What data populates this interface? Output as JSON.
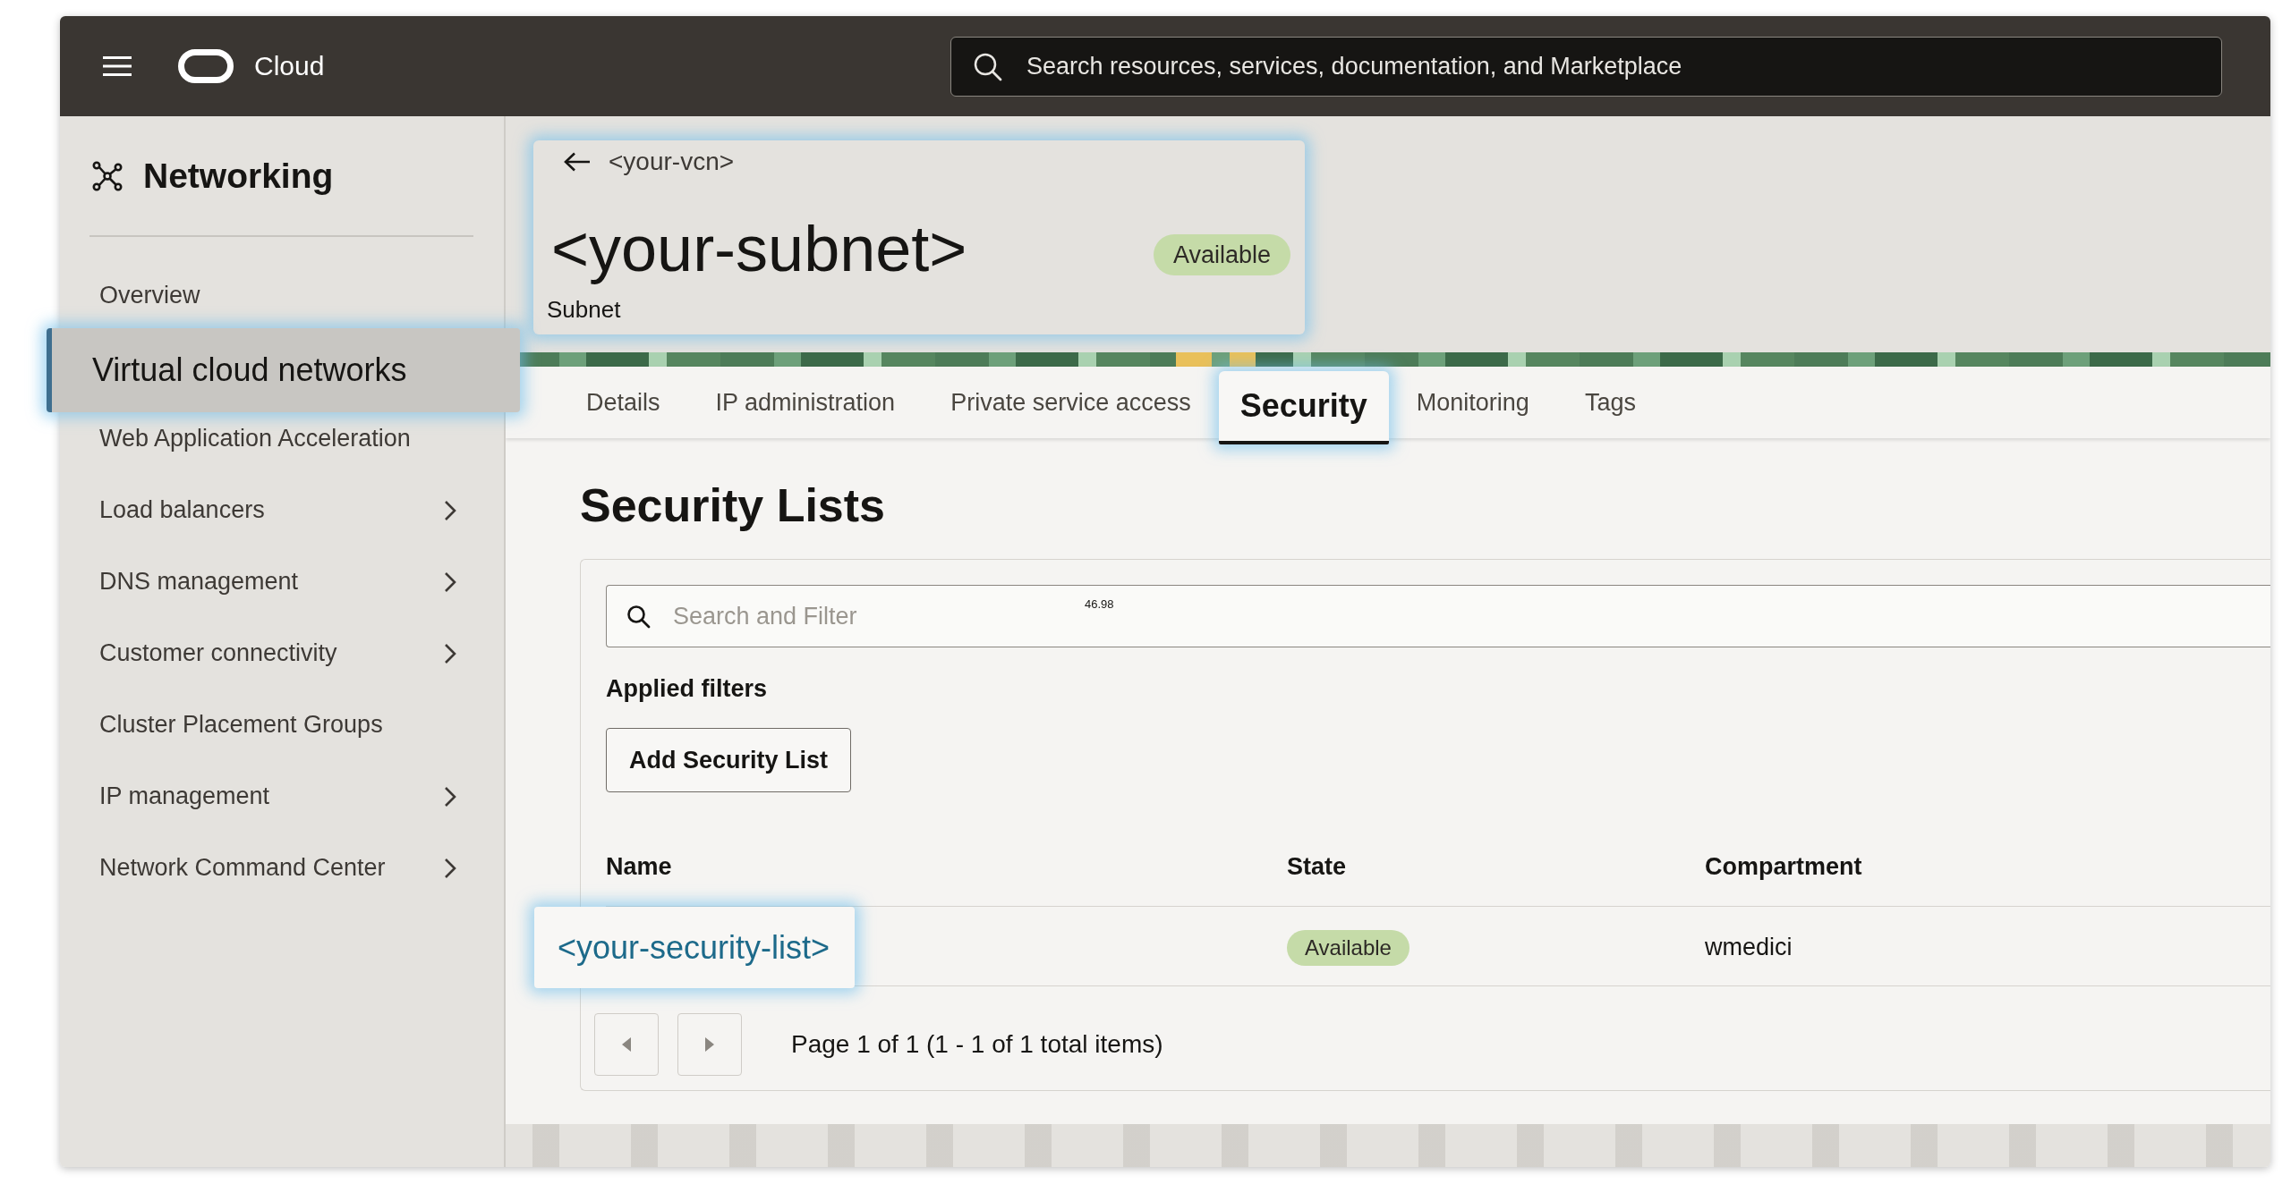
{
  "top_bar": {
    "brand": "Cloud",
    "search": {
      "placeholder": "Search resources, services, documentation, and Marketplace"
    }
  },
  "sidebar": {
    "title": "Networking",
    "items": [
      {
        "label": "Overview",
        "selected": false,
        "expandable": false
      },
      {
        "label": "Virtual cloud networks",
        "selected": true,
        "expandable": false
      },
      {
        "label": "Web Application Acceleration",
        "selected": false,
        "expandable": false
      },
      {
        "label": "Load balancers",
        "selected": false,
        "expandable": true
      },
      {
        "label": "DNS management",
        "selected": false,
        "expandable": true
      },
      {
        "label": "Customer connectivity",
        "selected": false,
        "expandable": true
      },
      {
        "label": "Cluster Placement Groups",
        "selected": false,
        "expandable": false
      },
      {
        "label": "IP management",
        "selected": false,
        "expandable": true
      },
      {
        "label": "Network Command Center",
        "selected": false,
        "expandable": true
      }
    ]
  },
  "header": {
    "back_link": "<your-vcn>",
    "title": "<your-subnet>",
    "status": "Available",
    "subtitle": "Subnet",
    "highlighted": true
  },
  "tabs": [
    {
      "label": "Details",
      "selected": false
    },
    {
      "label": "IP administration",
      "selected": false
    },
    {
      "label": "Private service access",
      "selected": false
    },
    {
      "label": "Security",
      "selected": true
    },
    {
      "label": "Monitoring",
      "selected": false
    },
    {
      "label": "Tags",
      "selected": false
    }
  ],
  "section": {
    "title": "Security Lists",
    "search": {
      "placeholder": "Search and Filter",
      "stray_value": "46.98"
    },
    "applied_filters_label": "Applied filters",
    "add_button": "Add Security List",
    "table": {
      "columns": [
        "Name",
        "State",
        "Compartment"
      ],
      "rows": [
        {
          "name": "<your-security-list>",
          "highlighted": true,
          "state": "Available",
          "compartment": "wmedici"
        }
      ]
    },
    "pagination": {
      "summary": "Page 1 of 1 (1 - 1 of 1 total items)"
    }
  }
}
